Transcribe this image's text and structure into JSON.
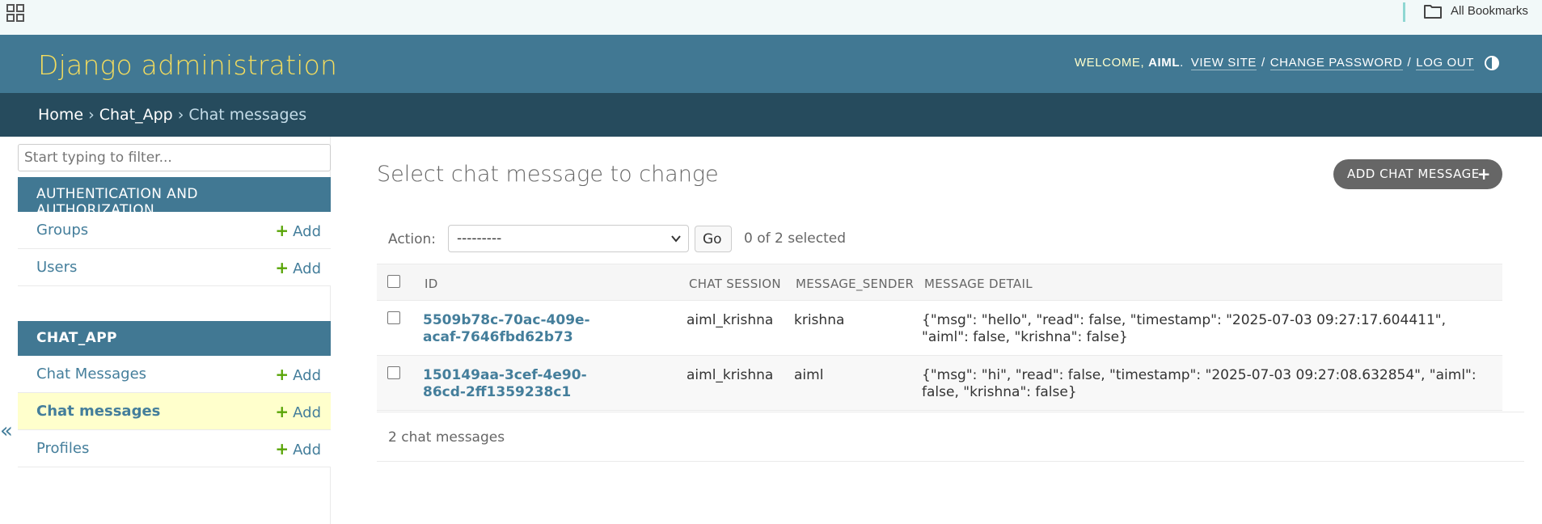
{
  "bookmarks": {
    "label": "All Bookmarks"
  },
  "header": {
    "branding": "Django administration",
    "welcome": "Welcome,",
    "user": "aiml",
    "view_site": "View site",
    "change_password": "Change password",
    "log_out": "Log out"
  },
  "breadcrumbs": {
    "home": "Home",
    "app": "Chat_App",
    "current": "Chat messages",
    "sep": "›"
  },
  "sidebar": {
    "filter_placeholder": "Start typing to filter...",
    "apps": [
      {
        "caption": "Authentication and Authorization",
        "models": [
          {
            "name": "Groups",
            "add": "Add"
          },
          {
            "name": "Users",
            "add": "Add"
          }
        ]
      },
      {
        "caption": "Chat_App",
        "models": [
          {
            "name": "Chat Messages",
            "add": "Add"
          },
          {
            "name": "Chat messages",
            "add": "Add",
            "current": true
          },
          {
            "name": "Profiles",
            "add": "Add"
          }
        ]
      }
    ],
    "collapse": "«"
  },
  "content": {
    "title": "Select chat message to change",
    "add_button": "Add chat message",
    "action_label": "Action:",
    "action_value": "---------",
    "go": "Go",
    "selected": "0 of 2 selected",
    "columns": [
      "ID",
      "Chat session",
      "Message_sender",
      "Message detail"
    ],
    "rows": [
      {
        "id": "5509b78c-70ac-409e-acaf-7646fbd62b73",
        "session": "aiml_krishna",
        "sender": "krishna",
        "detail": "{\"msg\": \"hello\", \"read\": false, \"timestamp\": \"2025-07-03 09:27:17.604411\", \"aiml\": false, \"krishna\": false}"
      },
      {
        "id": "150149aa-3cef-4e90-86cd-2ff1359238c1",
        "session": "aiml_krishna",
        "sender": "aiml",
        "detail": "{\"msg\": \"hi\", \"read\": false, \"timestamp\": \"2025-07-03 09:27:08.632854\", \"aiml\": false, \"krishna\": false}"
      }
    ],
    "paginator": "2 chat messages"
  },
  "colors": {
    "header": "#417893",
    "breadcrumbs": "#264b5d",
    "branding": "#f5dd5d",
    "link": "#447e9b",
    "add_plus": "#5aa508",
    "current_row": "#ffffcc"
  }
}
